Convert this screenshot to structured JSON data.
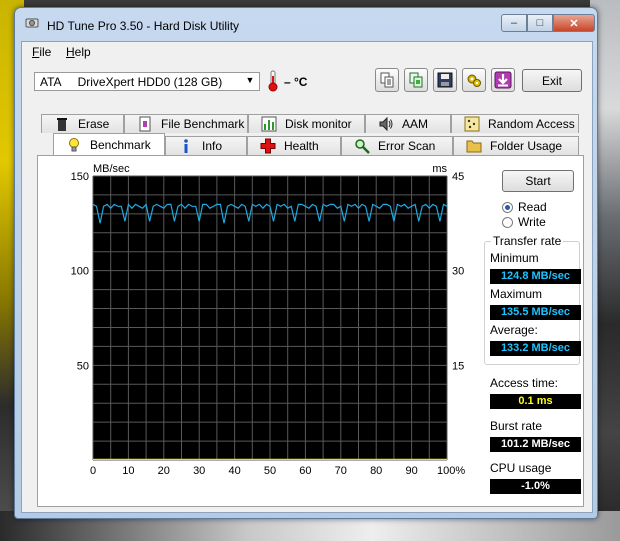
{
  "window": {
    "title": "HD Tune Pro 3.50 - Hard Disk Utility",
    "min_label": "–",
    "max_label": "□",
    "close_label": "✕"
  },
  "menu": {
    "file_first": "F",
    "file_rest": "ile",
    "help_first": "H",
    "help_rest": "elp"
  },
  "toolbar": {
    "drive_value": "ATA     DriveXpert HDD0 (128 GB)",
    "drive_arrow": "▼",
    "temperature": "– °C",
    "exit_label": "Exit",
    "icons": [
      "copy-text-icon",
      "copy-info-icon",
      "save-icon",
      "options-icon",
      "download-icon"
    ]
  },
  "tabs": {
    "top": [
      "Erase",
      "File Benchmark",
      "Disk monitor",
      "AAM",
      "Random Access"
    ],
    "bottom": [
      "Benchmark",
      "Info",
      "Health",
      "Error Scan",
      "Folder Usage"
    ],
    "active": "Benchmark"
  },
  "controls": {
    "start_label": "Start",
    "read_label": "Read",
    "write_label": "Write",
    "mode": "Read"
  },
  "stats": {
    "transfer_rate_label": "Transfer rate",
    "minimum_label": "Minimum",
    "minimum_value": "124.8 MB/sec",
    "maximum_label": "Maximum",
    "maximum_value": "135.5 MB/sec",
    "average_label": "Average:",
    "average_value": "133.2 MB/sec",
    "access_time_label": "Access time:",
    "access_time_value": "0.1 ms",
    "burst_rate_label": "Burst rate",
    "burst_rate_value": "101.2 MB/sec",
    "cpu_usage_label": "CPU usage",
    "cpu_usage_value": "-1.0%"
  },
  "colors": {
    "chart_bg": "#000000",
    "grid": "#595959",
    "transfer_line": "#1fa9e0",
    "access_line": "#e8e600",
    "stat_cyan": "#1dc3ff",
    "stat_yellow": "#ffff1a"
  },
  "chart_data": {
    "type": "line",
    "ylabel_left": "MB/sec",
    "ylabel_right": "ms",
    "left_ylim": [
      0,
      150
    ],
    "right_ylim": [
      0,
      45
    ],
    "left_ticks": [
      "150",
      "100",
      "50"
    ],
    "right_ticks": [
      "45",
      "30",
      "15"
    ],
    "x_ticks": [
      "0",
      "10",
      "20",
      "30",
      "40",
      "50",
      "60",
      "70",
      "80",
      "90",
      "100%"
    ],
    "xlim": [
      0,
      100
    ],
    "grid": true,
    "series": [
      {
        "name": "",
        "axis": "left",
        "x": [
          0,
          1,
          2,
          3,
          4,
          5,
          6,
          7,
          8,
          9,
          10,
          11,
          12,
          13,
          14,
          15,
          16,
          17,
          18,
          19,
          20,
          21,
          22,
          23,
          24,
          25,
          26,
          27,
          28,
          29,
          30,
          31,
          32,
          33,
          34,
          35,
          36,
          37,
          38,
          39,
          40,
          41,
          42,
          43,
          44,
          45,
          46,
          47,
          48,
          49,
          50,
          51,
          52,
          53,
          54,
          55,
          56,
          57,
          58,
          59,
          60,
          61,
          62,
          63,
          64,
          65,
          66,
          67,
          68,
          69,
          70,
          71,
          72,
          73,
          74,
          75,
          76,
          77,
          78,
          79,
          80,
          81,
          82,
          83,
          84,
          85,
          86,
          87,
          88,
          89,
          90,
          91,
          92,
          93,
          94,
          95,
          96,
          97,
          98,
          99,
          100
        ],
        "values": [
          135,
          134,
          125,
          134,
          135,
          133,
          135,
          134,
          134,
          126,
          135,
          133,
          135,
          134,
          133,
          135,
          126,
          134,
          135,
          134,
          133,
          135,
          135,
          126,
          134,
          135,
          133,
          135,
          134,
          134,
          126,
          135,
          135,
          133,
          134,
          135,
          135,
          125,
          134,
          135,
          134,
          133,
          135,
          134,
          126,
          135,
          134,
          135,
          133,
          135,
          134,
          126,
          135,
          134,
          135,
          133,
          134,
          126,
          135,
          135,
          134,
          133,
          135,
          134,
          126,
          135,
          134,
          135,
          135,
          133,
          134,
          126,
          135,
          134,
          135,
          133,
          135,
          134,
          126,
          135,
          134,
          133,
          135,
          135,
          134,
          126,
          135,
          134,
          135,
          133,
          134,
          135,
          126,
          134,
          135,
          133,
          135,
          134,
          126,
          135,
          134
        ]
      },
      {
        "name": "",
        "axis": "right",
        "x": [
          0,
          100
        ],
        "values": [
          0.1,
          0.1
        ]
      }
    ]
  }
}
